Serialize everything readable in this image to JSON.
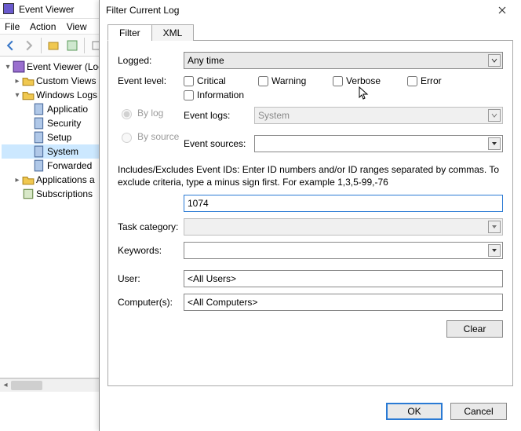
{
  "main": {
    "title": "Event Viewer",
    "menu": {
      "file": "File",
      "action": "Action",
      "view": "View"
    },
    "tree": {
      "root": "Event Viewer (Loc",
      "custom_views": "Custom Views",
      "windows_logs": "Windows Logs",
      "logs": {
        "application": "Applicatio",
        "security": "Security",
        "setup": "Setup",
        "system": "System",
        "forwarded": "Forwarded"
      },
      "apps_services": "Applications a",
      "subscriptions": "Subscriptions"
    }
  },
  "dialog": {
    "title": "Filter Current Log",
    "tabs": {
      "filter": "Filter",
      "xml": "XML"
    },
    "labels": {
      "logged": "Logged:",
      "event_level": "Event level:",
      "by_log": "By log",
      "by_source": "By source",
      "event_logs": "Event logs:",
      "event_sources": "Event sources:",
      "task_category": "Task category:",
      "keywords": "Keywords:",
      "user": "User:",
      "computers": "Computer(s):"
    },
    "logged_value": "Any time",
    "levels": {
      "critical": "Critical",
      "warning": "Warning",
      "verbose": "Verbose",
      "error": "Error",
      "information": "Information"
    },
    "event_logs_value": "System",
    "event_sources_value": "",
    "hint": "Includes/Excludes Event IDs: Enter ID numbers and/or ID ranges separated by commas. To exclude criteria, type a minus sign first. For example 1,3,5-99,-76",
    "event_ids_value": "1074",
    "task_category_value": "",
    "keywords_value": "",
    "user_value": "<All Users>",
    "computers_value": "<All Computers>",
    "buttons": {
      "clear": "Clear",
      "ok": "OK",
      "cancel": "Cancel"
    }
  }
}
